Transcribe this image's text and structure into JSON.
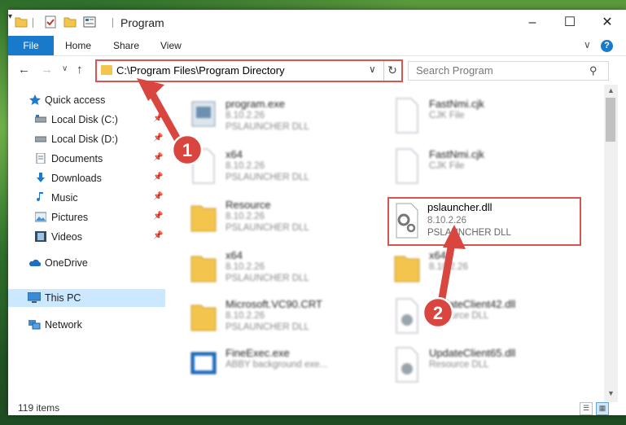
{
  "window": {
    "title": "Program",
    "controls": {
      "minimize": "–",
      "maximize": "☐",
      "close": "✕"
    }
  },
  "quick_access_toolbar": [
    "folder-icon",
    "properties-check-icon",
    "new-folder-icon",
    "properties-icon"
  ],
  "ribbon": {
    "tabs": [
      "File",
      "Home",
      "Share",
      "View"
    ],
    "help": "?"
  },
  "navigation": {
    "address": "C:\\Program Files\\Program Directory",
    "search_placeholder": "Search Program"
  },
  "sidebar": {
    "items": [
      {
        "label": "Quick access",
        "icon": "star-icon",
        "pinned": false
      },
      {
        "label": "Local Disk (C:)",
        "icon": "drive-icon",
        "pinned": true
      },
      {
        "label": "Local Disk (D:)",
        "icon": "drive-icon",
        "pinned": true
      },
      {
        "label": "Documents",
        "icon": "documents-icon",
        "pinned": true
      },
      {
        "label": "Downloads",
        "icon": "download-icon",
        "pinned": true
      },
      {
        "label": "Music",
        "icon": "music-icon",
        "pinned": true
      },
      {
        "label": "Pictures",
        "icon": "pictures-icon",
        "pinned": true
      },
      {
        "label": "Videos",
        "icon": "videos-icon",
        "pinned": true
      },
      {
        "label": "OneDrive",
        "icon": "cloud-icon",
        "pinned": false
      },
      {
        "label": "This PC",
        "icon": "computer-icon",
        "pinned": false,
        "selected": true
      },
      {
        "label": "Network",
        "icon": "network-icon",
        "pinned": false
      }
    ]
  },
  "files": {
    "left_column": [
      {
        "name": "program.exe",
        "version": "8.10.2.26",
        "description": "PSLAUNCHER DLL",
        "icon": "exe-icon"
      },
      {
        "name": "x64",
        "version": "8.10.2.26",
        "description": "PSLAUNCHER DLL",
        "icon": "file-icon"
      },
      {
        "name": "Resource",
        "version": "8.10.2.26",
        "description": "PSLAUNCHER DLL",
        "icon": "folder-icon"
      },
      {
        "name": "x64",
        "version": "8.10.2.26",
        "description": "PSLAUNCHER DLL",
        "icon": "folder-icon"
      },
      {
        "name": "Microsoft.VC90.CRT",
        "version": "8.10.2.26",
        "description": "PSLAUNCHER DLL",
        "icon": "folder-icon"
      },
      {
        "name": "FineExec.exe",
        "version": "ABBY background exe...",
        "description": "",
        "icon": "exe-icon"
      }
    ],
    "right_column": [
      {
        "name": "FastNmi.cjk",
        "version": "CJK File",
        "description": "",
        "icon": "file-icon"
      },
      {
        "name": "FastNmi.cjk",
        "version": "CJK File",
        "description": "",
        "icon": "file-icon"
      },
      {
        "name": "x64",
        "version": "8.10.2.26",
        "description": "",
        "icon": "folder-icon"
      },
      {
        "name": "UpdateClient42.dll",
        "version": "Resource DLL",
        "description": "",
        "icon": "dll-icon"
      },
      {
        "name": "UpdateClient65.dll",
        "version": "Resource DLL",
        "description": "",
        "icon": "dll-icon"
      }
    ],
    "highlighted": {
      "name": "pslauncher.dll",
      "version": "8.10.2.26",
      "description": "PSLAUNCHER DLL",
      "icon": "dll-gear-icon"
    }
  },
  "status": {
    "item_count": "119 items"
  },
  "annotations": [
    {
      "number": "1",
      "target": "address-bar"
    },
    {
      "number": "2",
      "target": "pslauncher.dll"
    }
  ],
  "colors": {
    "accent": "#1979ca",
    "highlight": "#d9534f",
    "selection": "#cce8ff"
  }
}
